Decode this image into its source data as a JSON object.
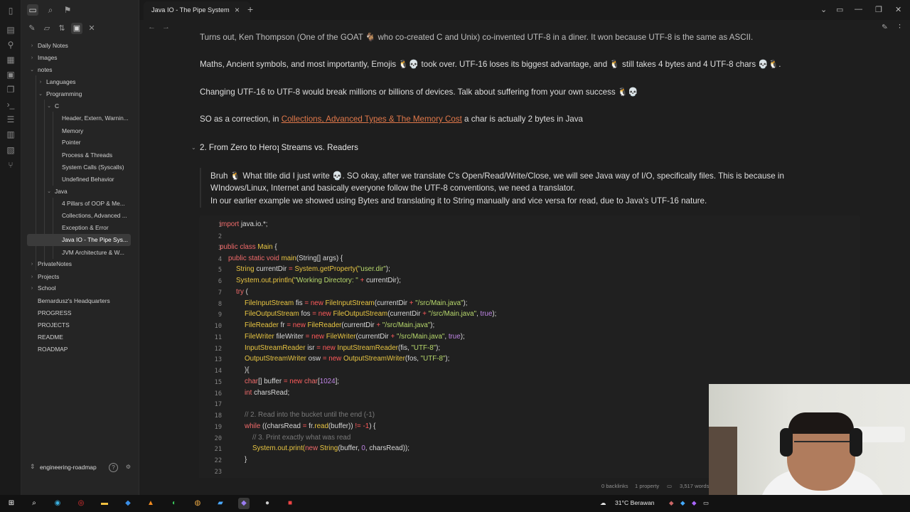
{
  "tab": {
    "title": "Java IO - The Pipe System"
  },
  "sidebar": {
    "tree": [
      {
        "label": "Daily Notes",
        "chev": "›"
      },
      {
        "label": "Images",
        "chev": "›"
      },
      {
        "label": "notes",
        "chev": "⌄"
      },
      {
        "label": "Programming",
        "chev": "⌄"
      },
      {
        "label": "Languages",
        "chev": "›"
      },
      {
        "label": "C",
        "chev": "⌄"
      },
      {
        "label": "Header, Extern, Warnin...",
        "chev": ""
      },
      {
        "label": "Memory",
        "chev": ""
      },
      {
        "label": "Pointer",
        "chev": ""
      },
      {
        "label": "Process & Threads",
        "chev": ""
      },
      {
        "label": "System Calls (Syscalls)",
        "chev": ""
      },
      {
        "label": "Undefined Behavior",
        "chev": ""
      },
      {
        "label": "Java",
        "chev": "⌄"
      },
      {
        "label": "4 Pillars of OOP & Me...",
        "chev": ""
      },
      {
        "label": "Collections, Advanced ...",
        "chev": ""
      },
      {
        "label": "Exception & Error",
        "chev": ""
      },
      {
        "label": "Java IO - The Pipe Sys...",
        "chev": ""
      },
      {
        "label": "JVM Architecture & W...",
        "chev": ""
      },
      {
        "label": "PrivateNotes",
        "chev": "›"
      },
      {
        "label": "Projects",
        "chev": "›"
      },
      {
        "label": "School",
        "chev": "›"
      },
      {
        "label": "Bernardusz's Headquarters",
        "chev": ""
      },
      {
        "label": "PROGRESS",
        "chev": ""
      },
      {
        "label": "PROJECTS",
        "chev": ""
      },
      {
        "label": "README",
        "chev": ""
      },
      {
        "label": "ROADMAP",
        "chev": ""
      }
    ],
    "vault": "engineering-roadmap"
  },
  "content": {
    "line0": "Turns out, Ken Thompson (One of the GOAT 🐐 who co-created C and Unix) co-invented UTF-8 in a diner. It won because UTF-8 is the same as ASCII.",
    "line1": "Maths, Ancient symbols, and most importantly, Emojis 🐧💀 took over. UTF-16 loses its biggest advantage, and 🐧 still takes 4 bytes and 4 UTF-8 chars 💀🐧.",
    "line2": "Changing UTF-16 to UTF-8 would break millions or billions of devices. Talk about suffering from your own success 🐧💀",
    "line3_pre": "SO as a correction, in ",
    "line3_link": "Collections, Advanced Types & The Memory Cost",
    "line3_post": " a char is actually 2 bytes in Java",
    "heading": "2. From Zero to Hero: Streams vs. Readers",
    "callout1": "Bruh 🐧 What title did I just write 💀. SO okay, after we translate C's Open/Read/Write/Close, we will see Java way of I/O, specifically files. This is because in",
    "callout2": "WIndows/Linux, Internet and basically everyone follow the UTF-8 conventions, we need a translator.",
    "callout3": "In our earlier example we showed using Bytes and translating it to String manually and vice versa for read, due to Java's UTF-16 nature."
  },
  "code": {
    "line_numbers": [
      "1",
      "2",
      "3",
      "4",
      "5",
      "6",
      "7",
      "8",
      "9",
      "10",
      "11",
      "12",
      "13",
      "14",
      "15",
      "16",
      "17",
      "18",
      "19",
      "20",
      "21",
      "22",
      "23"
    ],
    "l1_kw": "import",
    "l1_rest": " java.io.*;",
    "l3_kw": "public class",
    "l3_name": " Main",
    "l3_rest": " {",
    "l4_kw": "public static void",
    "l4_name": " main",
    "l4_rest": "(String[] args) {",
    "l5_ty": "String",
    "l5_a": " currentDir ",
    "l5_op": "=",
    "l5_b": " System.getProperty(",
    "l5_str": "\"user.dir\"",
    "l5_c": ");",
    "l6_ty": "System",
    "l6_a": ".out.println(",
    "l6_str": "\"Working Directory: \"",
    "l6_op": " + ",
    "l6_c": "currentDir);",
    "l7_kw": "try",
    "l7_rest": " (",
    "l8_ty": "FileInputStream",
    "l8_a": " fis ",
    "l8_op": "= new",
    "l8_ty2": " FileInputStream",
    "l8_b": "(currentDir ",
    "l8_op2": "+",
    "l8_str": " \"/src/Main.java\"",
    "l8_c": ");",
    "l9_ty": "FileOutputStream",
    "l9_a": " fos ",
    "l9_op": "= new",
    "l9_ty2": " FileOutputStream",
    "l9_b": "(currentDir ",
    "l9_op2": "+",
    "l9_str": " \"/src/Main.java\"",
    "l9_c": ", ",
    "l9_num": "true",
    "l9_d": ");",
    "l10_ty": "FileReader",
    "l10_a": " fr ",
    "l10_op": "= new",
    "l10_ty2": " FileReader",
    "l10_b": "(currentDir ",
    "l10_op2": "+",
    "l10_str": " \"/src/Main.java\"",
    "l10_c": ");",
    "l11_ty": "FileWriter",
    "l11_a": " fileWriter ",
    "l11_op": "= new",
    "l11_ty2": " FileWriter",
    "l11_b": "(currentDir ",
    "l11_op2": "+",
    "l11_str": " \"/src/Main.java\"",
    "l11_c": ", ",
    "l11_num": "true",
    "l11_d": ");",
    "l12_ty": "InputStreamReader",
    "l12_a": " isr ",
    "l12_op": "= new",
    "l12_ty2": " InputStreamReader",
    "l12_b": "(fis, ",
    "l12_str": "\"UTF-8\"",
    "l12_c": ");",
    "l13_ty": "OutputStreamWriter",
    "l13_a": " osw ",
    "l13_op": "= new",
    "l13_ty2": " OutputStreamWriter",
    "l13_b": "(fos, ",
    "l13_str": "\"UTF-8\"",
    "l13_c": ");",
    "l14": "){",
    "l15_kw": "char",
    "l15_a": "[] buffer ",
    "l15_op": "= new",
    "l15_kw2": " char",
    "l15_b": "[",
    "l15_num": "1024",
    "l15_c": "];",
    "l16_kw": "int",
    "l16_a": " charsRead;",
    "l18_cm": "// 2. Read into the bucket until the end (-1)",
    "l19_kw": "while",
    "l19_a": " ((charsRead ",
    "l19_op": "=",
    "l19_b": " fr.",
    "l19_fn": "read",
    "l19_c": "(buffer)) ",
    "l19_op2": "!= -1",
    "l19_d": ") {",
    "l20_cm": "// 3. Print exactly what was read",
    "l21_ty": "System",
    "l21_a": ".out.print(",
    "l21_kw": "new",
    "l21_ty2": " String",
    "l21_b": "(buffer, ",
    "l21_num": "0",
    "l21_c": ", charsRead));",
    "l22": "}"
  },
  "status": {
    "backlinks": "0 backlinks",
    "property": "1 property",
    "words": "3,517 words"
  },
  "taskbar": {
    "weather": "31°C  Berawan"
  },
  "icons": {
    "ribbon": [
      "sidebar-toggle-icon",
      "file-icon",
      "graph-icon",
      "grid-icon",
      "calendar-icon",
      "copy-icon",
      "terminal-icon",
      "list-icon",
      "book-icon",
      "archive-icon",
      "branch-icon"
    ]
  }
}
